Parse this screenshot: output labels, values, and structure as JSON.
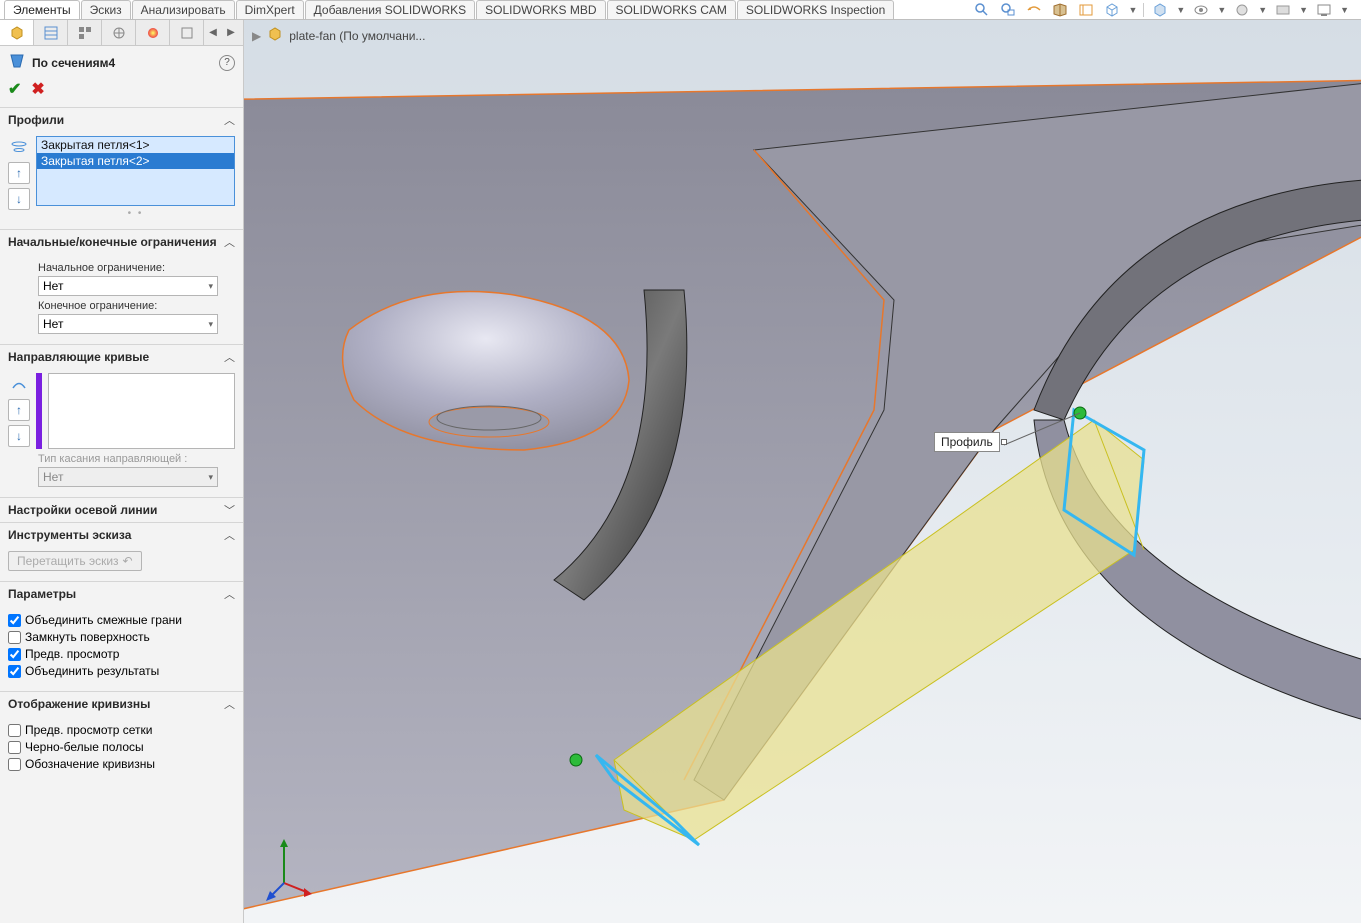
{
  "tabs": {
    "items": [
      "Элементы",
      "Эскиз",
      "Анализировать",
      "DimXpert",
      "Добавления SOLIDWORKS",
      "SOLIDWORKS MBD",
      "SOLIDWORKS CAM",
      "SOLIDWORKS Inspection"
    ],
    "active": 0
  },
  "breadcrumb": {
    "part": "plate-fan  (По умолчани..."
  },
  "feature": {
    "title": "По сечениям4"
  },
  "sections": {
    "profiles": {
      "label": "Профили",
      "items": [
        "Закрытая петля<1>",
        "Закрытая петля<2>"
      ],
      "selected": 1
    },
    "constraints": {
      "label": "Начальные/конечные ограничения",
      "start_label": "Начальное ограничение:",
      "start_value": "Нет",
      "end_label": "Конечное ограничение:",
      "end_value": "Нет"
    },
    "guides": {
      "label": "Направляющие кривые",
      "tangency_label": "Тип касания направляющей :",
      "tangency_value": "Нет"
    },
    "centerline": {
      "label": "Настройки осевой линии"
    },
    "sketchtools": {
      "label": "Инструменты эскиза",
      "drag_btn": "Перетащить эскиз"
    },
    "params": {
      "label": "Параметры",
      "merge_faces": "Объединить смежные грани",
      "close_surface": "Замкнуть поверхность",
      "preview": "Предв. просмотр",
      "merge_results": "Объединить результаты"
    },
    "curvature": {
      "label": "Отображение кривизны",
      "mesh_preview": "Предв. просмотр сетки",
      "zebra": "Черно-белые полосы",
      "curv_label": "Обозначение кривизны"
    }
  },
  "viewport": {
    "profile_label": "Профиль"
  }
}
